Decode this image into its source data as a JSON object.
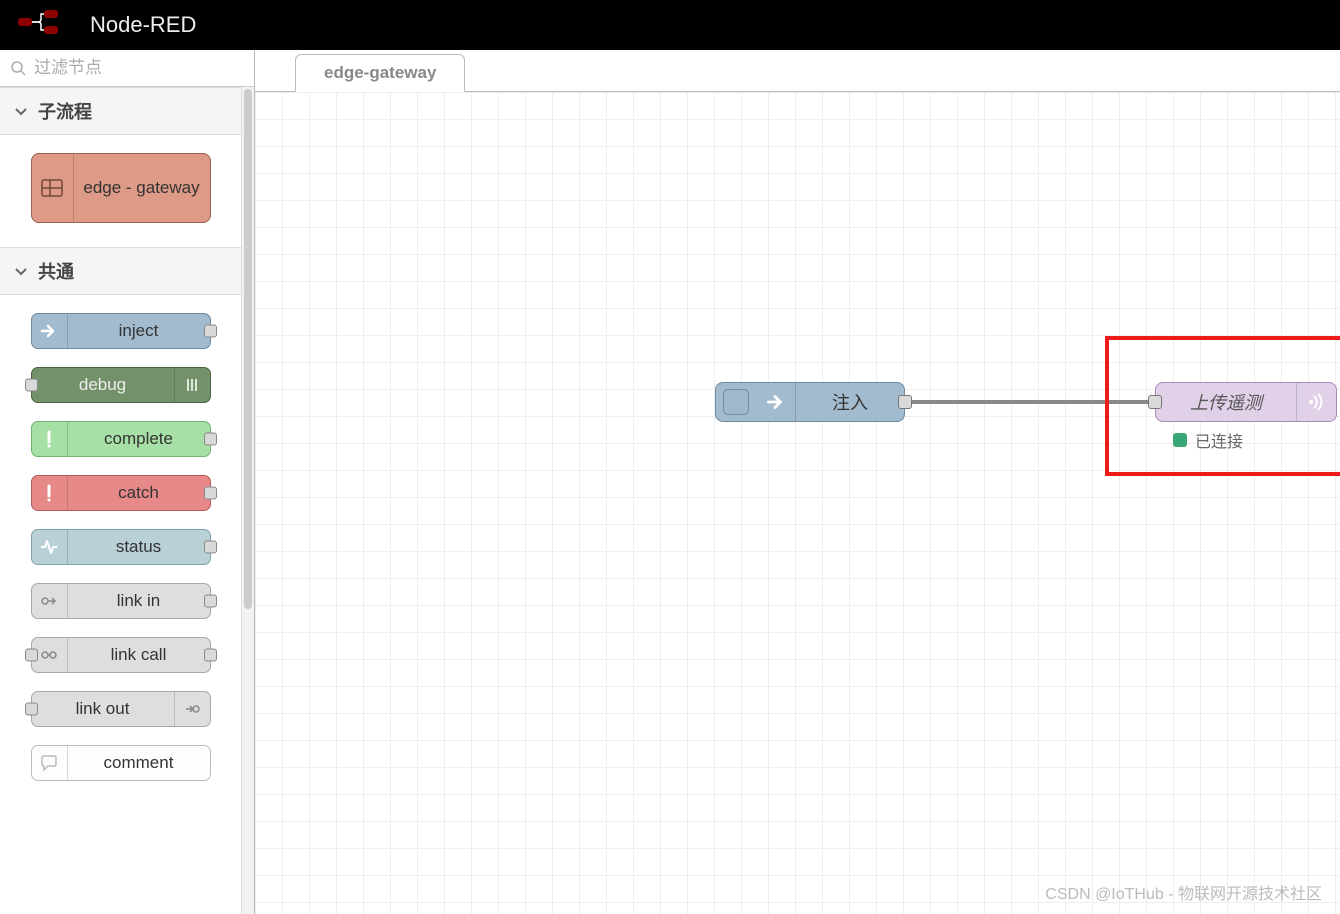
{
  "header": {
    "title": "Node-RED"
  },
  "palette": {
    "filter_placeholder": "过滤节点",
    "categories": [
      {
        "label": "子流程",
        "items": [
          {
            "label": "edge - gateway",
            "kind": "subflow"
          }
        ]
      },
      {
        "label": "共通",
        "items": [
          {
            "label": "inject",
            "kind": "inject"
          },
          {
            "label": "debug",
            "kind": "debug"
          },
          {
            "label": "complete",
            "kind": "complete"
          },
          {
            "label": "catch",
            "kind": "catch"
          },
          {
            "label": "status",
            "kind": "status"
          },
          {
            "label": "link in",
            "kind": "link-in"
          },
          {
            "label": "link call",
            "kind": "link-call"
          },
          {
            "label": "link out",
            "kind": "link-out"
          },
          {
            "label": "comment",
            "kind": "comment"
          }
        ]
      }
    ]
  },
  "tabs": [
    {
      "label": "edge-gateway",
      "active": true
    }
  ],
  "flow": {
    "nodes": {
      "inject": {
        "label": "注入"
      },
      "upload": {
        "label": "上传遥测",
        "status_text": "已连接",
        "status_color": "#3aa876"
      }
    }
  },
  "watermark": "CSDN @IoTHub - 物联网开源技术社区"
}
